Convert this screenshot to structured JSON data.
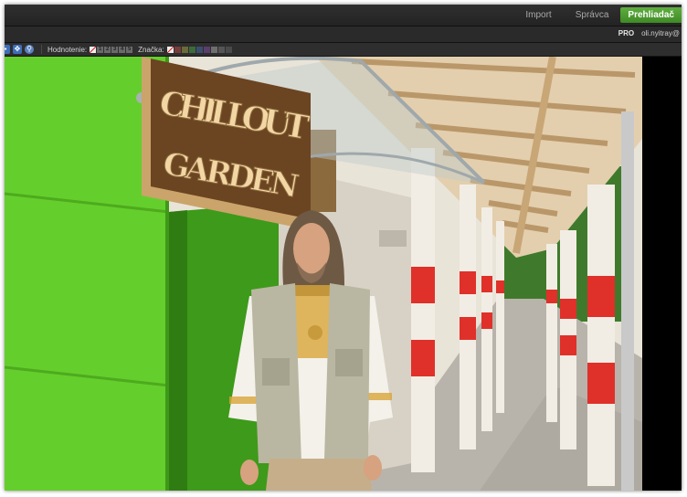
{
  "header": {
    "modules": [
      {
        "label": "Import",
        "active": false
      },
      {
        "label": "Správca",
        "active": false
      },
      {
        "label": "Prehliadač",
        "active": true
      }
    ]
  },
  "account": {
    "badge": "PRO",
    "user": "oli.nyitray@"
  },
  "toolbar": {
    "rating_label": "Hodnotenie:",
    "ratings": [
      "1",
      "2",
      "3",
      "4",
      "5"
    ],
    "label_label": "Značka:",
    "label_colors": [
      "#7a3b3b",
      "#6a6a3a",
      "#3c6a3a",
      "#3a4e6e",
      "#5a3e6e",
      "#6e6e6e",
      "#555555",
      "#4a4a4a"
    ]
  },
  "photo": {
    "sign_line1": "CHILLOUT",
    "sign_line2": "GARDEN"
  },
  "colors": {
    "accent": "#4f9d32",
    "wall": "#64cf2c",
    "post_red": "#e0302a"
  }
}
